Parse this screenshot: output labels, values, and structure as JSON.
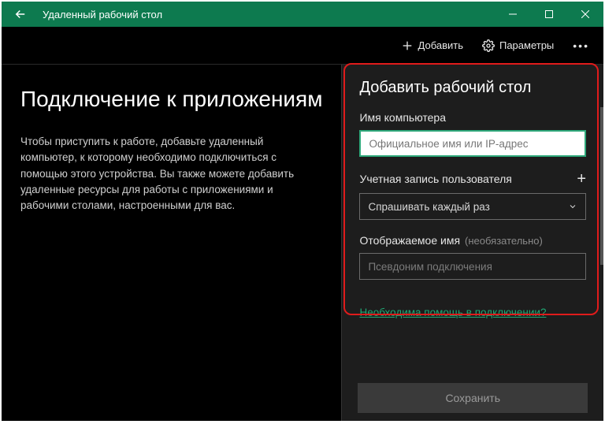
{
  "titlebar": {
    "title": "Удаленный рабочий стол"
  },
  "toolbar": {
    "add": "Добавить",
    "params": "Параметры"
  },
  "main": {
    "heading": "Подключение к приложениям",
    "body": "Чтобы приступить к работе, добавьте удаленный компьютер, к которому необходимо подключиться с помощью этого устройства. Вы также можете добавить удаленные ресурсы для работы с приложениями и рабочими столами, настроенными для вас."
  },
  "panel": {
    "title": "Добавить рабочий стол",
    "computer_label": "Имя компьютера",
    "computer_placeholder": "Официальное имя или IP-адрес",
    "account_label": "Учетная запись пользователя",
    "account_value": "Спрашивать каждый раз",
    "display_label": "Отображаемое имя",
    "display_optional": "(необязательно)",
    "display_placeholder": "Псевдоним подключения",
    "help_link": "Необходима помощь в подключении?",
    "save": "Сохранить"
  }
}
